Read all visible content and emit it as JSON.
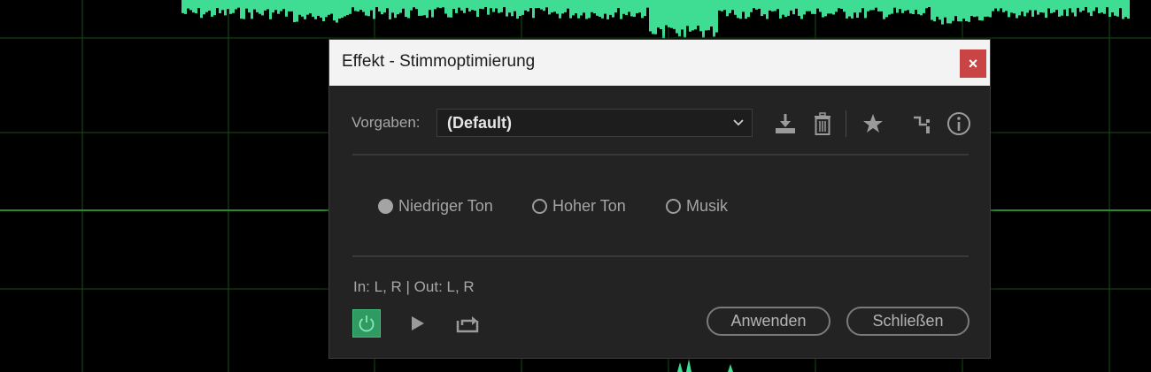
{
  "dialog": {
    "title": "Effekt - Stimmoptimierung",
    "close_label": "×",
    "presets": {
      "label": "Vorgaben:",
      "selected": "(Default)"
    },
    "toolbar_icons": [
      "download-icon",
      "trash-icon",
      "star-icon",
      "routing-icon",
      "info-icon"
    ],
    "mode_options": [
      {
        "label": "Niedriger Ton",
        "checked": true
      },
      {
        "label": "Hoher Ton",
        "checked": false
      },
      {
        "label": "Musik",
        "checked": false
      }
    ],
    "io_text": "In: L, R | Out: L, R",
    "apply_label": "Anwenden",
    "close_button_label": "Schließen"
  },
  "colors": {
    "waveform": "#3fdc94",
    "grid": "#1a5a1a",
    "power_on": "#2f9a62",
    "close_red": "#c94444"
  }
}
